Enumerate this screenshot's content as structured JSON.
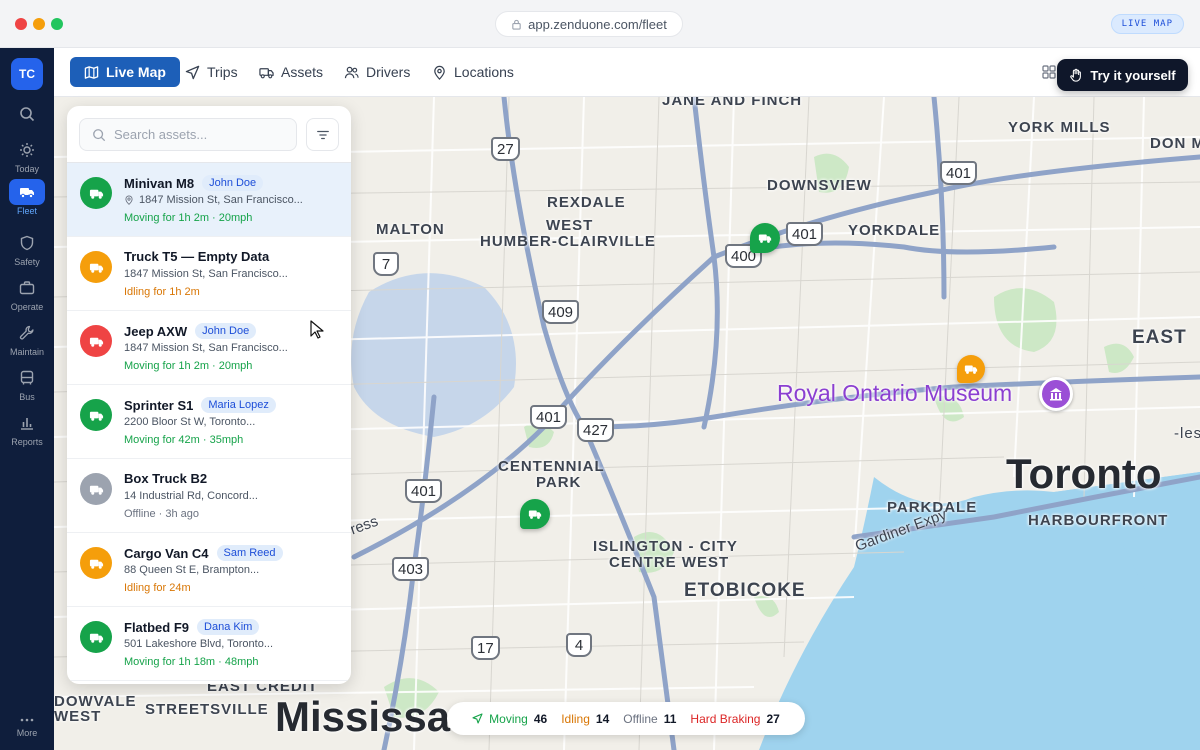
{
  "browser": {
    "url": "app.zenduone.com/fleet",
    "badge": "LIVE MAP"
  },
  "rail": {
    "avatar": "TC",
    "items": [
      {
        "label": "Today",
        "icon": "sun-icon"
      },
      {
        "label": "Fleet",
        "icon": "truck-icon",
        "active": true
      },
      {
        "label": "Safety",
        "icon": "shield-icon"
      },
      {
        "label": "Operate",
        "icon": "briefcase-icon"
      },
      {
        "label": "Maintain",
        "icon": "wrench-icon"
      },
      {
        "label": "Bus",
        "icon": "bus-icon"
      },
      {
        "label": "Reports",
        "icon": "bar-chart-icon"
      }
    ],
    "more": "More"
  },
  "nav": {
    "tabs": [
      {
        "label": "Live Map",
        "icon": "map-icon",
        "active": true
      },
      {
        "label": "Trips",
        "icon": "navigation-icon"
      },
      {
        "label": "Assets",
        "icon": "truck-icon"
      },
      {
        "label": "Drivers",
        "icon": "users-icon"
      },
      {
        "label": "Locations",
        "icon": "pin-icon"
      }
    ],
    "try_button": "Try it yourself"
  },
  "search": {
    "placeholder": "Search assets..."
  },
  "assets": [
    {
      "name": "Minivan M8",
      "driver": "John Doe",
      "address": "1847 Mission St, San Francisco...",
      "status": "Moving for 1h 2m · 20mph",
      "state": "moving",
      "color": "#16a34a",
      "show_pin": true
    },
    {
      "name": "Truck T5 — Empty Data",
      "driver": "",
      "address": "1847 Mission St, San Francisco...",
      "status": "Idling for 1h 2m",
      "state": "idling",
      "color": "#f59e0b"
    },
    {
      "name": "Jeep AXW",
      "driver": "John Doe",
      "address": "1847 Mission St, San Francisco...",
      "status": "Moving for 1h 2m · 20mph",
      "state": "moving",
      "color": "#ef4444"
    },
    {
      "name": "Sprinter S1",
      "driver": "Maria Lopez",
      "address": "2200 Bloor St W, Toronto...",
      "status": "Moving for 42m · 35mph",
      "state": "moving",
      "color": "#16a34a"
    },
    {
      "name": "Box Truck B2",
      "driver": "",
      "address": "14 Industrial Rd, Concord...",
      "status": "Offline · 3h ago",
      "state": "offline",
      "color": "#9ca3af"
    },
    {
      "name": "Cargo Van C4",
      "driver": "Sam Reed",
      "address": "88 Queen St E, Brampton...",
      "status": "Idling for 24m",
      "state": "idling",
      "color": "#f59e0b"
    },
    {
      "name": "Flatbed F9",
      "driver": "Dana Kim",
      "address": "501 Lakeshore Blvd, Toronto...",
      "status": "Moving for 1h 18m · 48mph",
      "state": "moving",
      "color": "#16a34a"
    }
  ],
  "status_colors": {
    "moving": "#16a34a",
    "idling": "#d97706",
    "offline": "#6b7280",
    "hard_braking": "#dc2626"
  },
  "summary": [
    {
      "label": "Moving",
      "count": "46",
      "key": "moving"
    },
    {
      "label": "Idling",
      "count": "14",
      "key": "idling"
    },
    {
      "label": "Offline",
      "count": "11",
      "key": "offline"
    },
    {
      "label": "Hard Braking",
      "count": "27",
      "key": "hard_braking"
    }
  ],
  "map": {
    "labels": [
      "JANE AND FINCH",
      "YORK MILLS",
      "DON M",
      "DOWNSVIEW",
      "REXDALE",
      "WEST",
      "HUMBER-CLAIRVILLE",
      "MALTON",
      "YORKDALE",
      "EAST",
      "CENTENNIAL",
      "PARK",
      "PARKDALE",
      "HARBOURFRONT",
      "ISLINGTON - CITY",
      "CENTRE WEST",
      "ETOBICOKE",
      "DOWVALE",
      "WEST",
      "STREETSVILLE",
      "EAST CREDIT",
      "Gardiner Expy",
      "ress",
      "-les"
    ],
    "big_labels": [
      "Toronto",
      "Mississa"
    ],
    "poi": "Royal Ontario Museum",
    "shields": [
      "27",
      "401",
      "401",
      "400",
      "409",
      "7",
      "401",
      "427",
      "401",
      "403",
      "17",
      "4"
    ]
  }
}
